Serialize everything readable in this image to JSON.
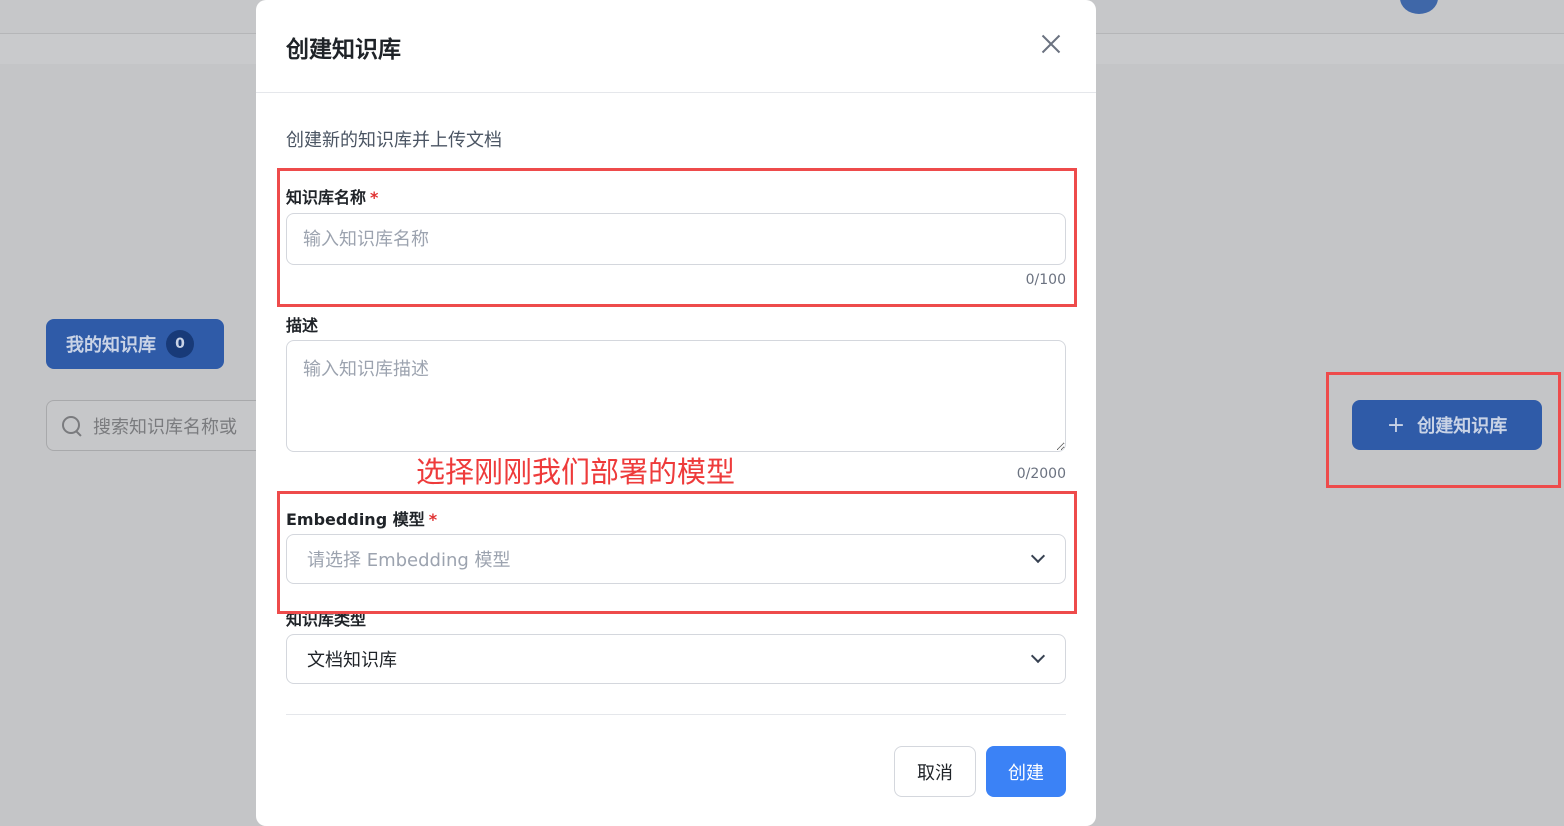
{
  "background": {
    "tab": {
      "label": "我的知识库",
      "count": "0"
    },
    "search": {
      "placeholder": "搜索知识库名称或"
    },
    "create_button": {
      "icon": "plus-icon",
      "label": "创建知识库"
    }
  },
  "modal": {
    "title": "创建知识库",
    "close_icon": "close-icon",
    "subtitle": "创建新的知识库并上传文档",
    "name_field": {
      "label": "知识库名称",
      "required_mark": "*",
      "placeholder": "输入知识库名称",
      "value": "",
      "counter": "0/100"
    },
    "description_field": {
      "label": "描述",
      "placeholder": "输入知识库描述",
      "value": "",
      "counter": "0/2000"
    },
    "embedding_field": {
      "label": "Embedding 模型",
      "required_mark": "*",
      "placeholder": "请选择 Embedding 模型"
    },
    "type_field": {
      "label": "知识库类型",
      "selected": "文档知识库"
    },
    "buttons": {
      "cancel": "取消",
      "create": "创建"
    }
  },
  "annotation": {
    "text": "选择刚刚我们部署的模型",
    "color": "#ee4b4b"
  },
  "colors": {
    "primary": "#3b82f6",
    "required": "#e03131"
  }
}
